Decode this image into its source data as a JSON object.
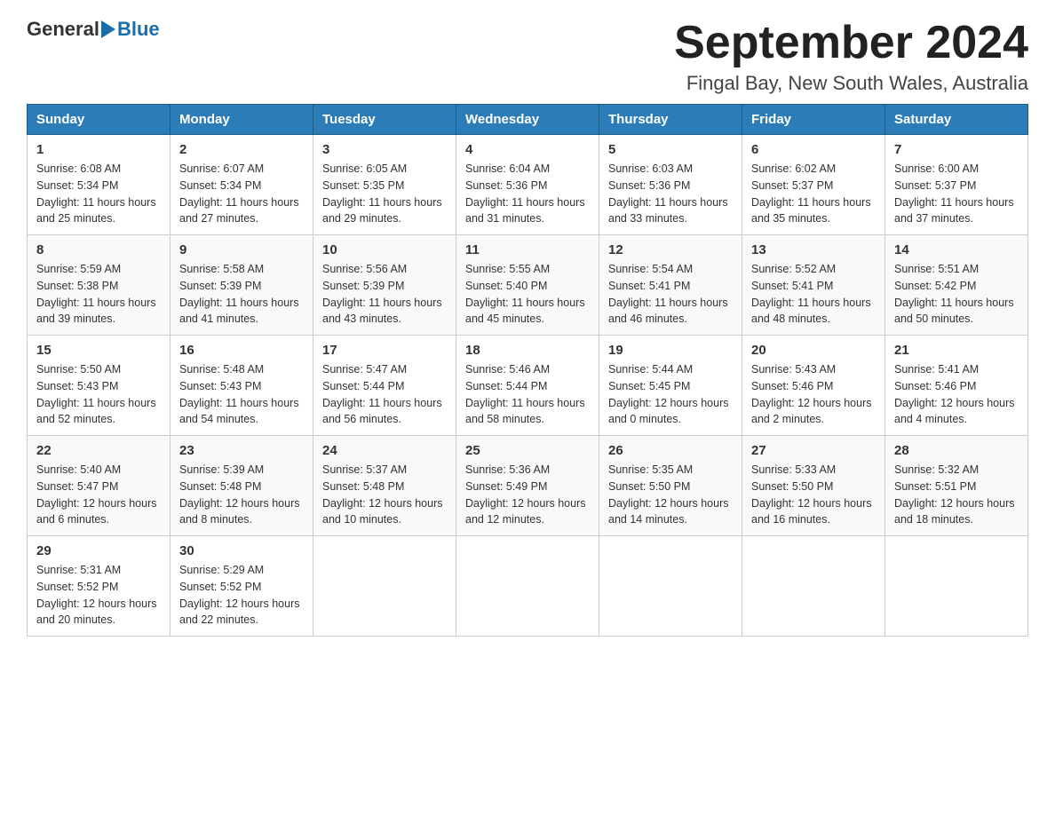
{
  "logo": {
    "general": "General",
    "blue": "Blue"
  },
  "title": "September 2024",
  "location": "Fingal Bay, New South Wales, Australia",
  "days_of_week": [
    "Sunday",
    "Monday",
    "Tuesday",
    "Wednesday",
    "Thursday",
    "Friday",
    "Saturday"
  ],
  "weeks": [
    [
      {
        "day": "1",
        "sunrise": "6:08 AM",
        "sunset": "5:34 PM",
        "daylight": "11 hours and 25 minutes."
      },
      {
        "day": "2",
        "sunrise": "6:07 AM",
        "sunset": "5:34 PM",
        "daylight": "11 hours and 27 minutes."
      },
      {
        "day": "3",
        "sunrise": "6:05 AM",
        "sunset": "5:35 PM",
        "daylight": "11 hours and 29 minutes."
      },
      {
        "day": "4",
        "sunrise": "6:04 AM",
        "sunset": "5:36 PM",
        "daylight": "11 hours and 31 minutes."
      },
      {
        "day": "5",
        "sunrise": "6:03 AM",
        "sunset": "5:36 PM",
        "daylight": "11 hours and 33 minutes."
      },
      {
        "day": "6",
        "sunrise": "6:02 AM",
        "sunset": "5:37 PM",
        "daylight": "11 hours and 35 minutes."
      },
      {
        "day": "7",
        "sunrise": "6:00 AM",
        "sunset": "5:37 PM",
        "daylight": "11 hours and 37 minutes."
      }
    ],
    [
      {
        "day": "8",
        "sunrise": "5:59 AM",
        "sunset": "5:38 PM",
        "daylight": "11 hours and 39 minutes."
      },
      {
        "day": "9",
        "sunrise": "5:58 AM",
        "sunset": "5:39 PM",
        "daylight": "11 hours and 41 minutes."
      },
      {
        "day": "10",
        "sunrise": "5:56 AM",
        "sunset": "5:39 PM",
        "daylight": "11 hours and 43 minutes."
      },
      {
        "day": "11",
        "sunrise": "5:55 AM",
        "sunset": "5:40 PM",
        "daylight": "11 hours and 45 minutes."
      },
      {
        "day": "12",
        "sunrise": "5:54 AM",
        "sunset": "5:41 PM",
        "daylight": "11 hours and 46 minutes."
      },
      {
        "day": "13",
        "sunrise": "5:52 AM",
        "sunset": "5:41 PM",
        "daylight": "11 hours and 48 minutes."
      },
      {
        "day": "14",
        "sunrise": "5:51 AM",
        "sunset": "5:42 PM",
        "daylight": "11 hours and 50 minutes."
      }
    ],
    [
      {
        "day": "15",
        "sunrise": "5:50 AM",
        "sunset": "5:43 PM",
        "daylight": "11 hours and 52 minutes."
      },
      {
        "day": "16",
        "sunrise": "5:48 AM",
        "sunset": "5:43 PM",
        "daylight": "11 hours and 54 minutes."
      },
      {
        "day": "17",
        "sunrise": "5:47 AM",
        "sunset": "5:44 PM",
        "daylight": "11 hours and 56 minutes."
      },
      {
        "day": "18",
        "sunrise": "5:46 AM",
        "sunset": "5:44 PM",
        "daylight": "11 hours and 58 minutes."
      },
      {
        "day": "19",
        "sunrise": "5:44 AM",
        "sunset": "5:45 PM",
        "daylight": "12 hours and 0 minutes."
      },
      {
        "day": "20",
        "sunrise": "5:43 AM",
        "sunset": "5:46 PM",
        "daylight": "12 hours and 2 minutes."
      },
      {
        "day": "21",
        "sunrise": "5:41 AM",
        "sunset": "5:46 PM",
        "daylight": "12 hours and 4 minutes."
      }
    ],
    [
      {
        "day": "22",
        "sunrise": "5:40 AM",
        "sunset": "5:47 PM",
        "daylight": "12 hours and 6 minutes."
      },
      {
        "day": "23",
        "sunrise": "5:39 AM",
        "sunset": "5:48 PM",
        "daylight": "12 hours and 8 minutes."
      },
      {
        "day": "24",
        "sunrise": "5:37 AM",
        "sunset": "5:48 PM",
        "daylight": "12 hours and 10 minutes."
      },
      {
        "day": "25",
        "sunrise": "5:36 AM",
        "sunset": "5:49 PM",
        "daylight": "12 hours and 12 minutes."
      },
      {
        "day": "26",
        "sunrise": "5:35 AM",
        "sunset": "5:50 PM",
        "daylight": "12 hours and 14 minutes."
      },
      {
        "day": "27",
        "sunrise": "5:33 AM",
        "sunset": "5:50 PM",
        "daylight": "12 hours and 16 minutes."
      },
      {
        "day": "28",
        "sunrise": "5:32 AM",
        "sunset": "5:51 PM",
        "daylight": "12 hours and 18 minutes."
      }
    ],
    [
      {
        "day": "29",
        "sunrise": "5:31 AM",
        "sunset": "5:52 PM",
        "daylight": "12 hours and 20 minutes."
      },
      {
        "day": "30",
        "sunrise": "5:29 AM",
        "sunset": "5:52 PM",
        "daylight": "12 hours and 22 minutes."
      },
      null,
      null,
      null,
      null,
      null
    ]
  ],
  "labels": {
    "sunrise": "Sunrise:",
    "sunset": "Sunset:",
    "daylight": "Daylight:"
  }
}
